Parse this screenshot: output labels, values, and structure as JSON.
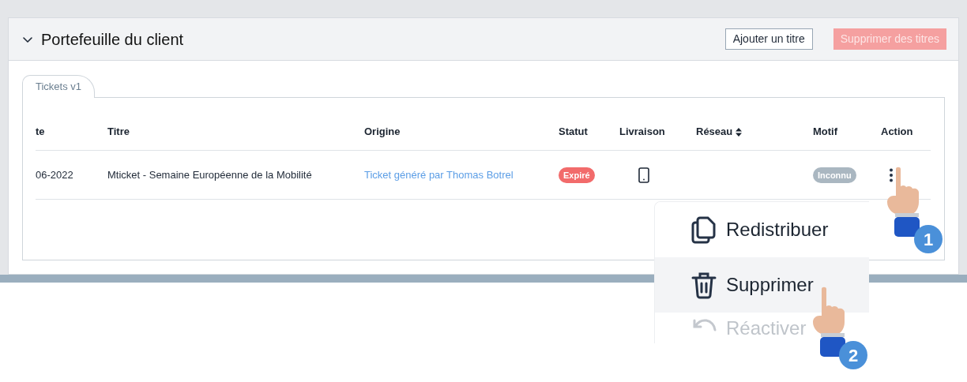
{
  "panel": {
    "title": "Portefeuille du client",
    "expanded": true,
    "buttons": [
      {
        "label": "Ajouter un titre",
        "kind": "outline"
      },
      {
        "label": "Supprimer des titres",
        "kind": "danger",
        "disabled": true
      }
    ]
  },
  "tabs": [
    {
      "label": "Tickets v1",
      "selected": true
    }
  ],
  "table": {
    "columns": [
      {
        "label": "te",
        "sortable": false
      },
      {
        "label": "Titre",
        "sortable": false
      },
      {
        "label": "Origine",
        "sortable": false
      },
      {
        "label": "Statut",
        "sortable": false
      },
      {
        "label": "Livraison",
        "sortable": false
      },
      {
        "label": "Réseau",
        "sortable": true
      },
      {
        "label": "Motif",
        "sortable": false
      },
      {
        "label": "Action",
        "sortable": false
      }
    ],
    "rows": [
      {
        "date": "06-2022",
        "title": "Mticket - Semaine Européenne de la Mobilité",
        "origin": "Ticket généré par Thomas Botrel",
        "status": {
          "label": "Expiré",
          "color": "#f26b6b"
        },
        "delivery": {
          "kind": "phone"
        },
        "motif": {
          "label": "Inconnu",
          "color": "#aab7c1"
        }
      }
    ]
  },
  "menu": {
    "items": [
      {
        "label": "Redistribuer",
        "kind": "copy",
        "selected": false,
        "disabled": false
      },
      {
        "label": "Supprimer",
        "kind": "trash",
        "selected": true,
        "disabled": false
      },
      {
        "label": "Réactiver",
        "kind": "undo",
        "selected": false,
        "disabled": true
      }
    ]
  },
  "steps": [
    {
      "label": "1"
    },
    {
      "label": "2"
    }
  ]
}
